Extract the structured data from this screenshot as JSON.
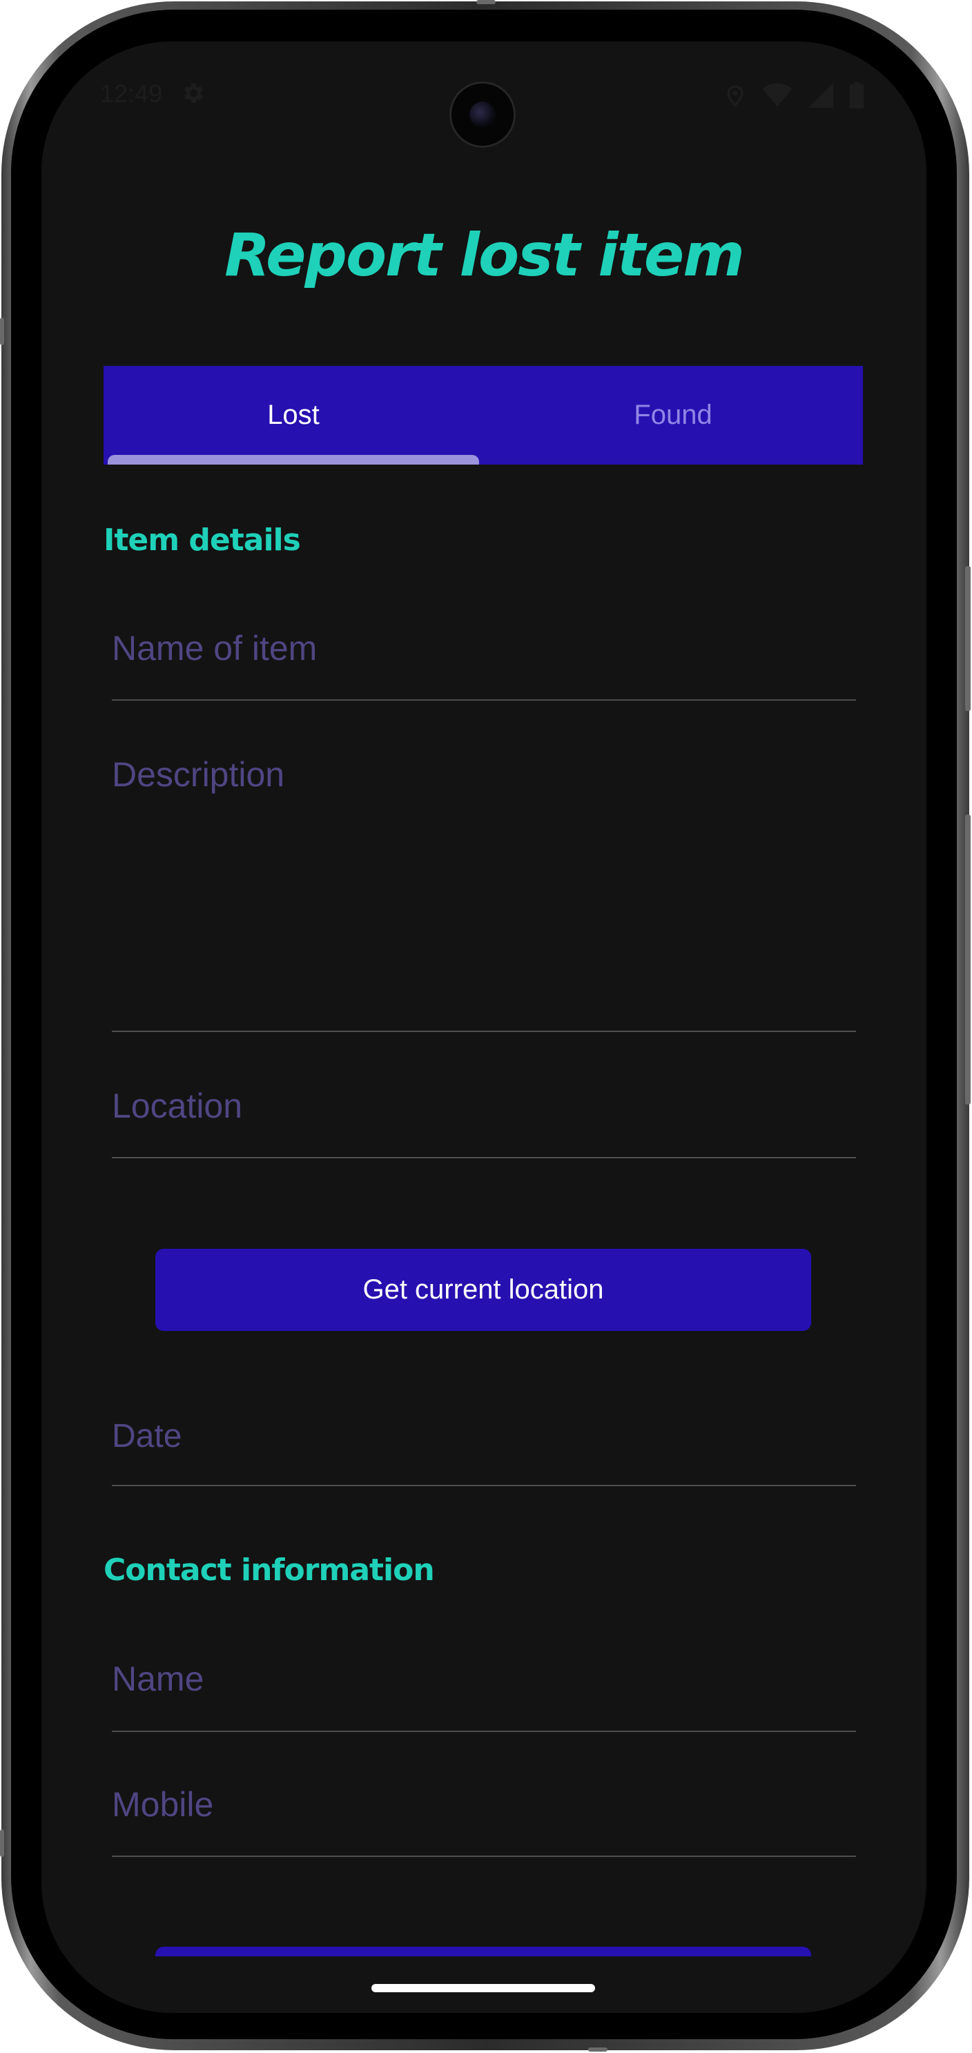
{
  "status_bar": {
    "time": "12:49",
    "icons": [
      "gear-icon",
      "location-icon",
      "wifi-icon",
      "signal-icon",
      "battery-icon"
    ]
  },
  "header": {
    "title": "Report lost item"
  },
  "tabs": [
    {
      "label": "Lost",
      "active": true
    },
    {
      "label": "Found",
      "active": false
    }
  ],
  "item_details": {
    "heading": "Item details",
    "name_placeholder": "Name of item",
    "description_placeholder": "Description",
    "location_placeholder": "Location",
    "get_location_label": "Get current location",
    "date_placeholder": "Date"
  },
  "contact_information": {
    "heading": "Contact information",
    "name_placeholder": "Name",
    "mobile_placeholder": "Mobile"
  },
  "colors": {
    "accent": "#1fd1b9",
    "primary": "#2610b0",
    "background": "#131313",
    "placeholder": "#4f4683"
  }
}
